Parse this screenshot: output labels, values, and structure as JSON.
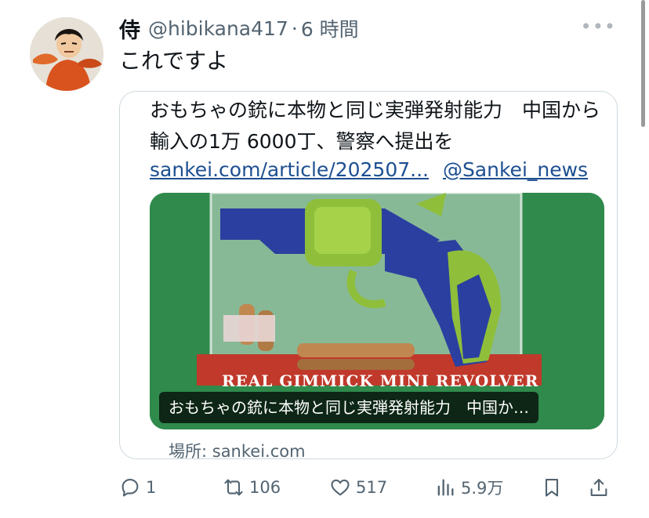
{
  "post": {
    "display_name": "侍",
    "handle": "@hibikana417",
    "separator": "·",
    "time": "6 時間",
    "more": "•••",
    "text": "これですよ"
  },
  "card": {
    "title": "おもちゃの銃に本物と同じ実弾発射能力　中国から輸入の1万 6000丁、警察へ提出を",
    "link_url": "sankei.com/article/202507...",
    "link_account": "@Sankei_news",
    "media_caption": "おもちゃの銃に本物と同じ実弾発射能力　中国か…",
    "packaging_text": "REAL GIMMICK MINI REVOLVER",
    "source": "場所: sankei.com"
  },
  "actions": {
    "reply_count": "1",
    "retweet_count": "106",
    "like_count": "517",
    "views_count": "5.9万"
  },
  "icons": {
    "reply": "reply-icon",
    "retweet": "retweet-icon",
    "like": "heart-icon",
    "views": "views-icon",
    "bookmark": "bookmark-icon",
    "share": "share-icon"
  },
  "colors": {
    "link": "#1d4f91",
    "muted": "#536471",
    "border": "#cfd9de",
    "media_bg": "#2e8b4a"
  }
}
